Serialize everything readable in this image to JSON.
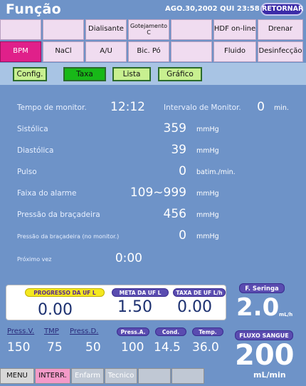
{
  "header": {
    "title": "Função",
    "datetime": "AGO.30,2002 QUI 23:58",
    "return_label": "RETORNAR"
  },
  "tabs_row1": [
    "",
    "",
    "Dialisante",
    "Gotejamento C",
    "",
    "HDF on-line",
    "Drenar"
  ],
  "tabs_row2": [
    "BPM",
    "NaCl",
    "A/U",
    "Bic. Pó",
    "",
    "Fluido",
    "Desinfecção"
  ],
  "subbuttons": [
    "Config.",
    "Taxa",
    "Lista",
    "Gráfico"
  ],
  "monitor": {
    "tempo_label": "Tempo de monitor.",
    "tempo_value": "12:12",
    "intervalo_label": "Intervalo de Monitor.",
    "intervalo_value": "0",
    "intervalo_unit": "min.",
    "sistolica_label": "Sistólica",
    "sistolica_value": "359",
    "sistolica_unit": "mmHg",
    "diastolica_label": "Diastólica",
    "diastolica_value": "39",
    "diastolica_unit": "mmHg",
    "pulso_label": "Pulso",
    "pulso_value": "0",
    "pulso_unit": "batim./min.",
    "faixa_label": "Faixa do alarme",
    "faixa_value": "109~999",
    "faixa_unit": "mmHg",
    "pressao_label": "Pressão da braçadeira",
    "pressao_value": "456",
    "pressao_unit": "mmHg",
    "pressao_nm_label": "Pressão da braçadeira (no monitor.)",
    "pressao_nm_value": "0",
    "pressao_nm_unit": "mmHg",
    "proximo_label": "Próximo vez",
    "proximo_value": "0:00"
  },
  "uf": {
    "progresso_label": "PROGRESSO DA UF  L",
    "progresso_value": "0.00",
    "meta_label": "META DA UF  L",
    "meta_value": "1.50",
    "taxa_label": "TAXA DE UF  L/h",
    "taxa_value": "0.00"
  },
  "pressures": {
    "pv_label": "Press.V.",
    "pv_value": "150",
    "tmp_label": "TMP",
    "tmp_value": "75",
    "pd_label": "Press.D.",
    "pd_value": "50",
    "pa_label": "Press.A.",
    "pa_value": "100",
    "cond_label": "Cond.",
    "cond_value": "14.5",
    "temp_label": "Temp.",
    "temp_value": "36.0"
  },
  "right": {
    "seringa_label": "F. Seringa",
    "seringa_value": "2.0",
    "seringa_unit": "mL/h",
    "fluxo_label": "FLUXO SANGUE",
    "fluxo_value": "200",
    "fluxo_unit": "mL/min"
  },
  "footer": [
    "MENU",
    "INTERR.",
    "Enfarm",
    "Tecnico",
    "",
    ""
  ]
}
